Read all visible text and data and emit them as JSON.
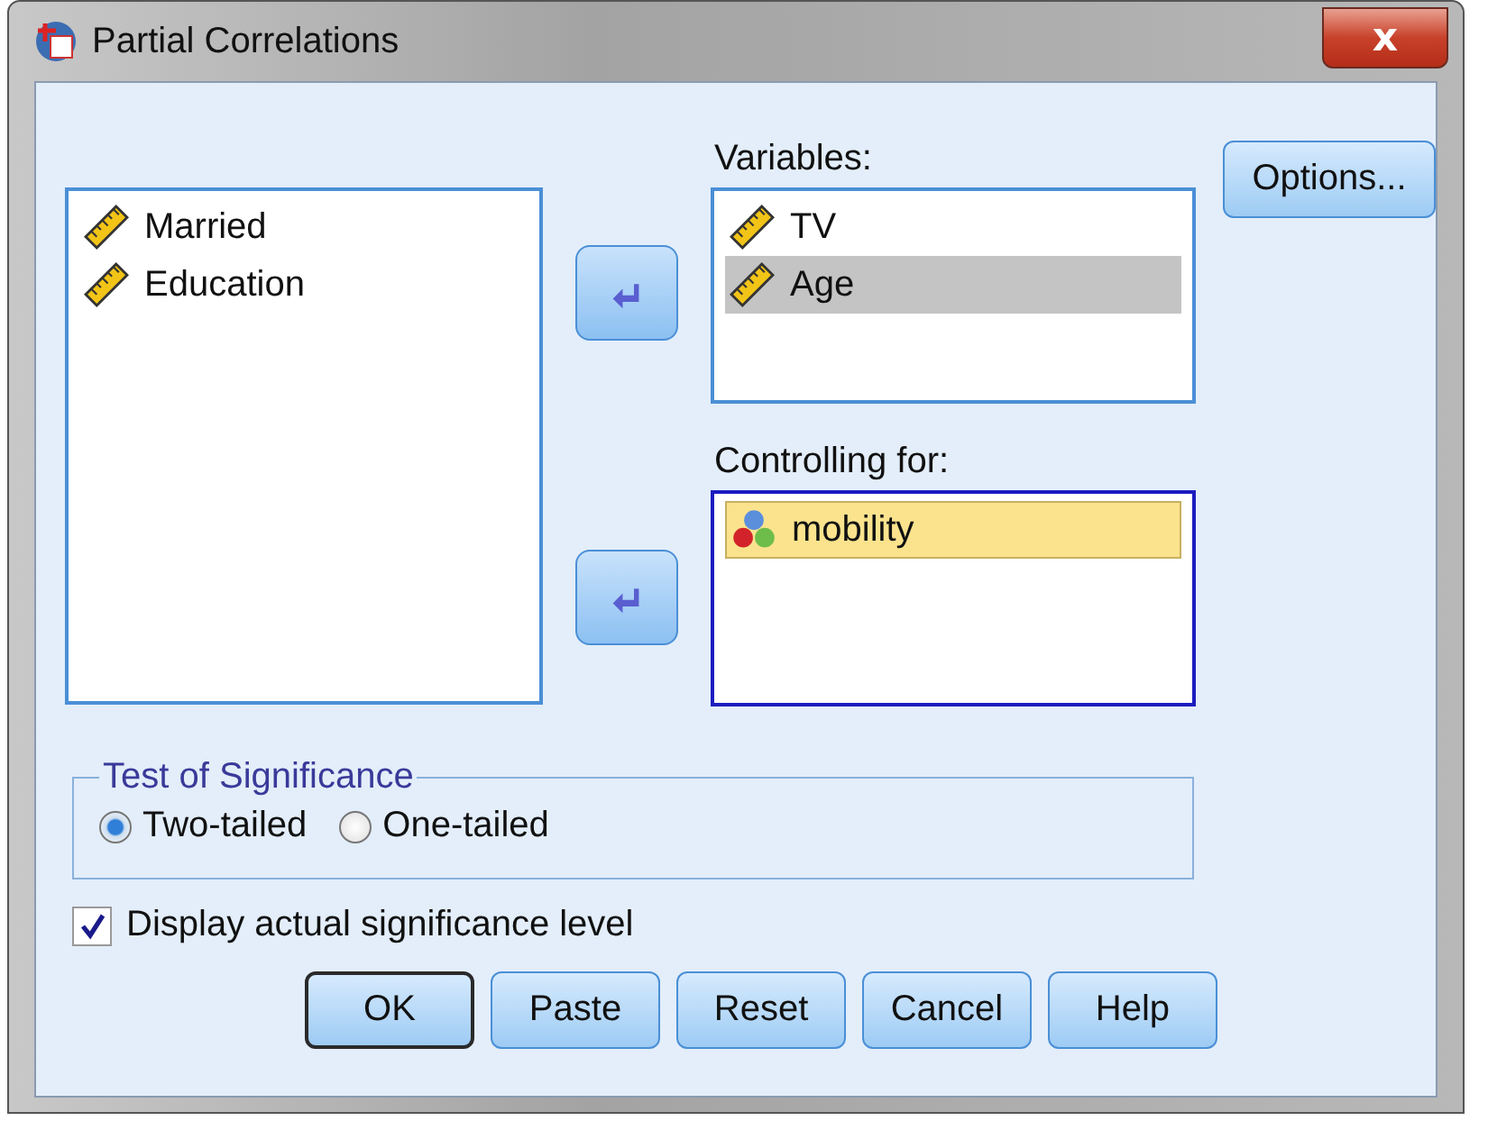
{
  "window": {
    "title": "Partial Correlations",
    "close": "x"
  },
  "source_list": {
    "items": [
      {
        "label": "Married",
        "kind": "scale",
        "selected": false
      },
      {
        "label": "Education",
        "kind": "scale",
        "selected": false
      }
    ]
  },
  "variables": {
    "label": {
      "text": "Variables:"
    },
    "items": [
      {
        "label": "TV",
        "kind": "scale",
        "selected": false
      },
      {
        "label": "Age",
        "kind": "scale",
        "selected": true
      }
    ]
  },
  "controlling": {
    "label": {
      "text": "Controlling for:"
    },
    "focused": true,
    "items": [
      {
        "label": "mobility",
        "kind": "nominal",
        "selected": true
      }
    ]
  },
  "options_button": {
    "text": "Options..."
  },
  "significance": {
    "title": "Test of Significance",
    "options": [
      {
        "text": "Two-tailed",
        "selected": true
      },
      {
        "text": "One-tailed",
        "selected": false
      }
    ]
  },
  "display_actual": {
    "text": "Display actual significance level",
    "checked": true
  },
  "buttons": [
    {
      "text": "OK",
      "default": true
    },
    {
      "text": "Paste",
      "default": false
    },
    {
      "text": "Reset",
      "default": false
    },
    {
      "text": "Cancel",
      "default": false
    },
    {
      "text": "Help",
      "default": false
    }
  ]
}
